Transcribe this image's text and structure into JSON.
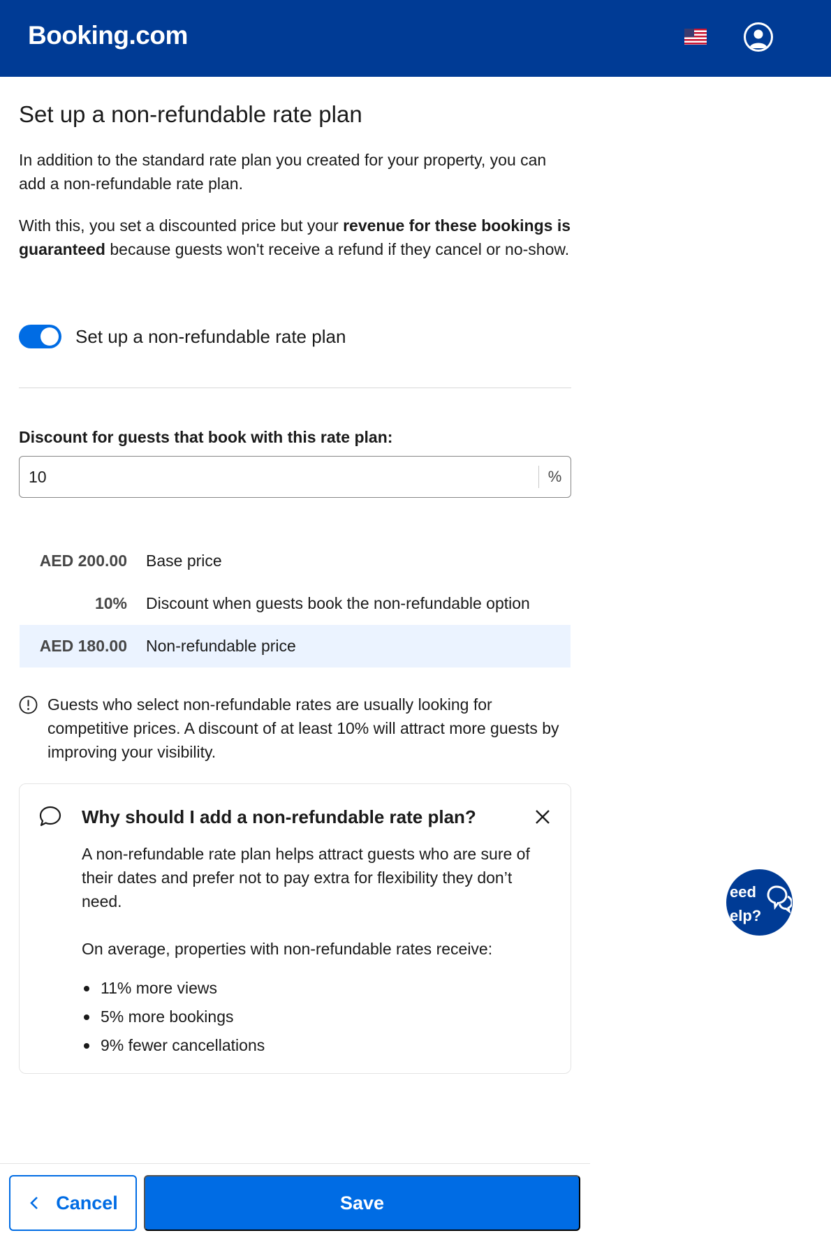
{
  "header": {
    "brand": "Booking.com",
    "flag_icon": "us-flag-icon",
    "account_icon": "user-account-icon"
  },
  "page": {
    "title": "Set up a non-refundable rate plan",
    "intro": "In addition to the standard rate plan you created for your property, you can add a non-refundable rate plan.",
    "detail_pre": "With this, you set a discounted price but your ",
    "detail_bold": "revenue for these bookings is guaranteed",
    "detail_post": " because guests won't receive a refund if they cancel or no-show.",
    "toggle": {
      "label": "Set up a non-refundable rate plan",
      "on": true
    }
  },
  "discount": {
    "label": "Discount for guests that book with this rate plan:",
    "value": "10",
    "unit": "%"
  },
  "price_table": [
    {
      "amount": "AED 200.00",
      "desc": "Base price",
      "highlight": false
    },
    {
      "amount": "10%",
      "desc": "Discount when guests book the non-refundable option",
      "highlight": false
    },
    {
      "amount": "AED 180.00",
      "desc": "Non-refundable price",
      "highlight": true
    }
  ],
  "info": {
    "icon": "info-icon",
    "text": "Guests who select non-refundable rates are usually looking for competitive prices. A discount of at least 10% will attract more guests by improving your visibility."
  },
  "card": {
    "icon": "speech-bubble-icon",
    "title": "Why should I add a non-refundable rate plan?",
    "body": "A non-refundable rate plan helps attract guests who are sure of their dates and prefer not to pay extra for flexibility they don’t need.",
    "subhead": "On average, properties with non-refundable rates receive:",
    "items": [
      "11% more views",
      "5% more bookings",
      "9% fewer cancellations"
    ]
  },
  "help_widget": {
    "line1": "eed",
    "line2": "elp?",
    "icon": "chat-help-icon"
  },
  "footer": {
    "cancel_label": "Cancel",
    "save_label": "Save"
  },
  "colors": {
    "brand_dark": "#003b95",
    "primary": "#006ce4",
    "highlight_row": "#ebf3ff"
  }
}
